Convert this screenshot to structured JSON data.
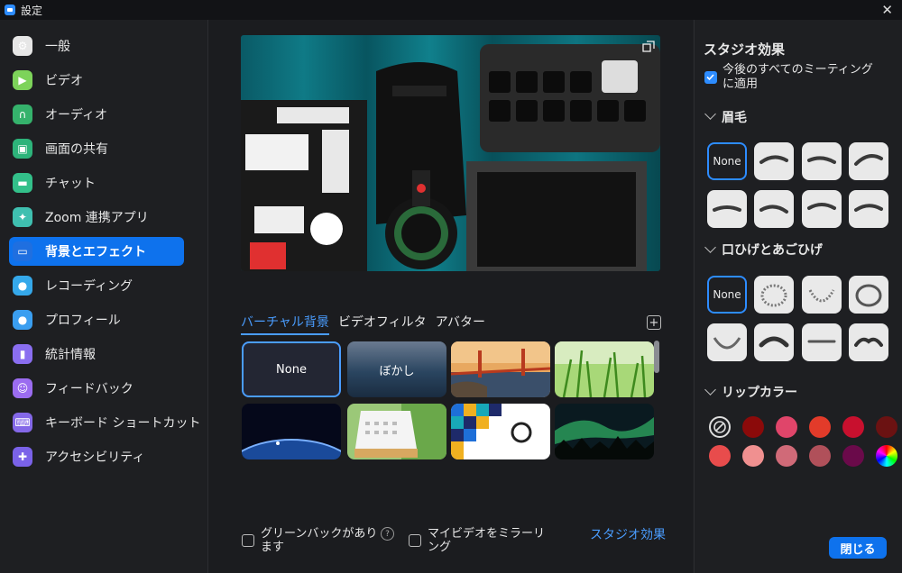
{
  "window": {
    "title": "設定"
  },
  "sidebar": {
    "items": [
      {
        "label": "一般",
        "icon": "gear-icon",
        "color": "#e6e6e6"
      },
      {
        "label": "ビデオ",
        "icon": "video-icon",
        "color": "#7dd35a"
      },
      {
        "label": "オーディオ",
        "icon": "headphones-icon",
        "color": "#35b26c"
      },
      {
        "label": "画面の共有",
        "icon": "share-screen-icon",
        "color": "#2db37a"
      },
      {
        "label": "チャット",
        "icon": "chat-icon",
        "color": "#33c08a"
      },
      {
        "label": "Zoom 連携アプリ",
        "icon": "apps-icon",
        "color": "#3fbfb0"
      },
      {
        "label": "背景とエフェクト",
        "icon": "background-icon",
        "color": "#1f6fe0"
      },
      {
        "label": "レコーディング",
        "icon": "record-icon",
        "color": "#35a8ea"
      },
      {
        "label": "プロフィール",
        "icon": "profile-icon",
        "color": "#3a9ef0"
      },
      {
        "label": "統計情報",
        "icon": "stats-icon",
        "color": "#8a6ef0"
      },
      {
        "label": "フィードバック",
        "icon": "feedback-icon",
        "color": "#9b6cf0"
      },
      {
        "label": "キーボード ショートカット",
        "icon": "keyboard-icon",
        "color": "#8468e8"
      },
      {
        "label": "アクセシビリティ",
        "icon": "accessibility-icon",
        "color": "#7a62e8"
      }
    ],
    "active_index": 6
  },
  "center": {
    "tabs": [
      "バーチャル背景",
      "ビデオフィルタ",
      "アバター"
    ],
    "active_tab": 0,
    "backgrounds": [
      {
        "label": "None",
        "selected": true
      },
      {
        "label": "ぼかし"
      },
      {
        "label": ""
      },
      {
        "label": ""
      },
      {
        "label": ""
      },
      {
        "label": ""
      },
      {
        "label": ""
      },
      {
        "label": ""
      }
    ],
    "green_screen_label": "グリーンバックがあります",
    "mirror_label": "マイビデオをミラーリング",
    "studio_link": "スタジオ効果"
  },
  "studio": {
    "title": "スタジオ効果",
    "apply_label": "今後のすべてのミーティングに適用",
    "apply_checked": true,
    "eyebrows_title": "眉毛",
    "mustache_title": "口ひげとあごひげ",
    "lip_title": "リップカラー",
    "none_label": "None",
    "lip_colors": [
      "#none",
      "#8b0a0a",
      "#e0456a",
      "#e23b2a",
      "#c8102e",
      "#6b1212",
      "#e84c4c",
      "#f09090",
      "#d06a78",
      "#b0505a",
      "#6a0a4a",
      "#rainbow"
    ]
  },
  "footer": {
    "close_label": "閉じる"
  }
}
